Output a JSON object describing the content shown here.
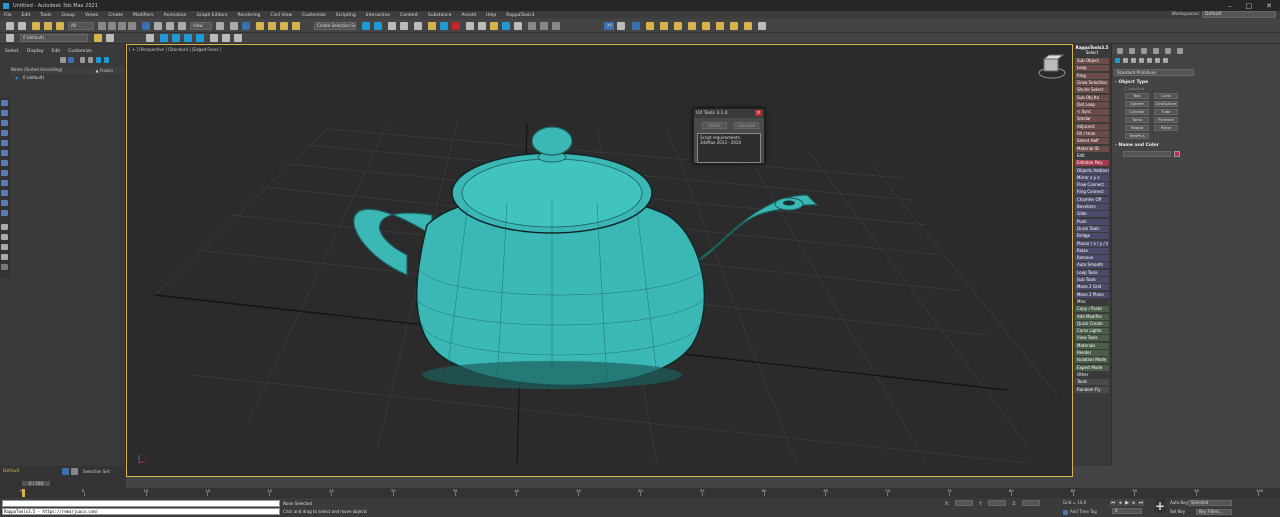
{
  "window": {
    "title": "Untitled - Autodesk 3ds Max 2021",
    "controls": [
      "–",
      "□",
      "✕"
    ],
    "workspaces_label": "Workspaces:",
    "workspaces_value": "Default"
  },
  "menu": [
    "File",
    "Edit",
    "Tools",
    "Group",
    "Views",
    "Create",
    "Modifiers",
    "Animation",
    "Graph Editors",
    "Rendering",
    "Civil View",
    "Customize",
    "Scripting",
    "Interactive",
    "Content",
    "Substance",
    "Arnold",
    "Help",
    "RappaTools3"
  ],
  "toolbar": {
    "filter_value": "All",
    "view_value": "View",
    "selection_set_value": "Create Selection Se",
    "axes": [
      "X",
      "Y",
      "Z"
    ],
    "axis_constraint": "XY",
    "layer_value": "0 (default)"
  },
  "scene_explorer": {
    "tabs": [
      "Select",
      "Display",
      "Edit",
      "Customize"
    ],
    "column_header": "Name (Sorted Ascending)",
    "frozen_label": "▲ Frozen",
    "rows": [
      {
        "label": "0 (default)"
      }
    ],
    "layer_label": "Default",
    "selection_set_label": "Selection Set:",
    "frame_counter": "0 / 100"
  },
  "viewport": {
    "label": "[ + ] [Perspective ] [Standard ] [Edged Faces ]"
  },
  "ux_dialog": {
    "title": "UX Tools 3.1.4",
    "install_button": "Install",
    "uninstall_button": "Uninstall",
    "text_lines": [
      "Script requirements:",
      "3dsMax 2013 - 2020"
    ]
  },
  "rappatools": {
    "header_line1": "RappaTools3.5",
    "header_line2": "Select",
    "buttons": [
      {
        "label": "Sub Object",
        "color": "#6b4a4a"
      },
      {
        "label": "Loop",
        "color": "#6b4a4a"
      },
      {
        "label": "Ring",
        "color": "#6b4a4a"
      },
      {
        "label": "Grow Selection",
        "color": "#6b4a4a"
      },
      {
        "label": "Shrink Select",
        "color": "#6b4a4a"
      },
      {
        "label": "Sub Obj Ito",
        "color": "#6b4a4a"
      },
      {
        "label": "Dot Loop",
        "color": "#6b4a4a"
      },
      {
        "label": "< Sync",
        "color": "#6b4a4a"
      },
      {
        "label": "Similar",
        "color": "#6b4a4a"
      },
      {
        "label": "Adjacent",
        "color": "#6b4a4a"
      },
      {
        "label": "Fill / Hole",
        "color": "#6b4a4a"
      },
      {
        "label": "Select Half",
        "color": "#6b4a4a"
      },
      {
        "label": "Material ID",
        "color": "#6b4a4a"
      },
      {
        "label": "Edit",
        "color": "#3a3a3a"
      },
      {
        "label": "Editable Poly",
        "color": "#a03b4b"
      },
      {
        "label": "Objects Add/ons",
        "color": "#4a4a6b"
      },
      {
        "label": "Mirror   x y z",
        "color": "#4a4a6b"
      },
      {
        "label": "Flow Connect",
        "color": "#4a4a6b"
      },
      {
        "label": "Ring Connect",
        "color": "#4a4a6b"
      },
      {
        "label": "Chamfer Off",
        "color": "#4a4a6b"
      },
      {
        "label": "Bevel/ers",
        "color": "#4a4a6b"
      },
      {
        "label": "Slide",
        "color": "#4a4a6b"
      },
      {
        "label": "Push",
        "color": "#4a4a6b"
      },
      {
        "label": "Quick Tools",
        "color": "#4a4a6b"
      },
      {
        "label": "Bridge",
        "color": "#4a4a6b"
      },
      {
        "label": "Planar  / x / y / z",
        "color": "#4a4a6b"
      },
      {
        "label": "Relax",
        "color": "#4a4a6b"
      },
      {
        "label": "Remove",
        "color": "#4a4a6b"
      },
      {
        "label": "Auto Smooth",
        "color": "#4a4a6b"
      },
      {
        "label": "Loop Tools",
        "color": "#4a4a6b"
      },
      {
        "label": "Sub Tools",
        "color": "#4a4a6b"
      },
      {
        "label": "Move 2 Grid",
        "color": "#4a4a6b"
      },
      {
        "label": "Move 2 Plane",
        "color": "#4a4a6b"
      },
      {
        "label": "Misc",
        "color": "#3a3a3a"
      },
      {
        "label": "Copy / Paste",
        "color": "#4a5e4a"
      },
      {
        "label": "Add Modifier",
        "color": "#4a5e4a"
      },
      {
        "label": "Quick Create",
        "color": "#4a5e4a"
      },
      {
        "label": "Cams Lights",
        "color": "#4a5e4a"
      },
      {
        "label": "View Tools",
        "color": "#4a5e4a"
      },
      {
        "label": "Materials",
        "color": "#4a5e4a"
      },
      {
        "label": "Render",
        "color": "#4a5e4a"
      },
      {
        "label": "Isolation Mode",
        "color": "#4a5e4a"
      },
      {
        "label": "Expert Mode",
        "color": "#4a5e4a"
      },
      {
        "label": "Other",
        "color": "#3a3a3a"
      },
      {
        "label": "Tools",
        "color": "#4a4a4a"
      },
      {
        "label": "Random Fly",
        "color": "#4a4a4a"
      }
    ]
  },
  "command_panel": {
    "category": "Standard Primitives",
    "object_type_header": "Object Type",
    "autogrid_label": "AutoGrid",
    "object_buttons": [
      [
        "Box",
        "Cone"
      ],
      [
        "Sphere",
        "GeoSphere"
      ],
      [
        "Cylinder",
        "Tube"
      ],
      [
        "Torus",
        "Pyramid"
      ],
      [
        "Teapot",
        "Plane"
      ],
      [
        "TextPlus",
        ""
      ]
    ],
    "name_color_header": "Name and Color",
    "swatch_color": "#c8226e"
  },
  "timeline": {
    "ticks": [
      0,
      5,
      10,
      15,
      20,
      25,
      30,
      35,
      40,
      45,
      50,
      55,
      60,
      65,
      70,
      75,
      80,
      85,
      90,
      95,
      100
    ]
  },
  "status": {
    "maxscript_line": "RappaTools3.5 - https://remarjuaco.com/",
    "selection_text": "None Selected",
    "prompt_text": "Click and drag to select and move objects",
    "x_label": "X:",
    "y_label": "Y:",
    "z_label": "Z:",
    "grid_text": "Grid = 10,0",
    "add_time_tag": "Add Time Tag",
    "auto_key": "Auto Key",
    "selected_value": "Selected",
    "set_key": "Set Key",
    "key_filters": "Key Filters...",
    "frame_value": "0"
  },
  "colors": {
    "accent": "#1e9ad6",
    "teapot": "#3bb8b5",
    "viewport_border": "#d8b24c",
    "layer_label": "#d8b24c",
    "close_red": "#c1272d"
  }
}
